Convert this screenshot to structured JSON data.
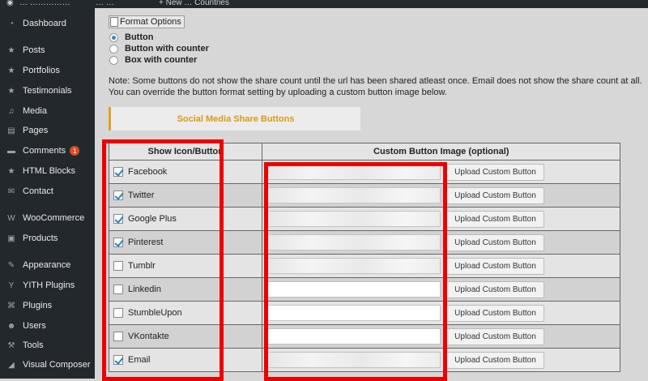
{
  "adminbar": {
    "site_name": "… ……………",
    "counters": "…  …",
    "new_label": "+ New … Countries"
  },
  "sidebar": {
    "items": [
      {
        "label": "Dashboard",
        "icon": "dashboard-icon",
        "glyph": "◔"
      },
      {
        "label": "Posts",
        "icon": "pin-icon",
        "glyph": "★"
      },
      {
        "label": "Portfolios",
        "icon": "pin-icon",
        "glyph": "★"
      },
      {
        "label": "Testimonials",
        "icon": "pin-icon",
        "glyph": "★"
      },
      {
        "label": "Media",
        "icon": "media-icon",
        "glyph": "♫"
      },
      {
        "label": "Pages",
        "icon": "pages-icon",
        "glyph": "▤"
      },
      {
        "label": "Comments",
        "icon": "comment-icon",
        "glyph": "▬",
        "badge": "1"
      },
      {
        "label": "HTML Blocks",
        "icon": "pin-icon",
        "glyph": "★"
      },
      {
        "label": "Contact",
        "icon": "mail-icon",
        "glyph": "✉"
      },
      {
        "label": "WooCommerce",
        "icon": "woocommerce-icon",
        "glyph": "W"
      },
      {
        "label": "Products",
        "icon": "products-icon",
        "glyph": "▣"
      },
      {
        "label": "Appearance",
        "icon": "brush-icon",
        "glyph": "✎"
      },
      {
        "label": "YITH Plugins",
        "icon": "yith-icon",
        "glyph": "Y"
      },
      {
        "label": "Plugins",
        "icon": "plug-icon",
        "glyph": "⌘"
      },
      {
        "label": "Users",
        "icon": "users-icon",
        "glyph": "☻"
      },
      {
        "label": "Tools",
        "icon": "wrench-icon",
        "glyph": "⚒"
      },
      {
        "label": "Visual Composer",
        "icon": "composer-icon",
        "glyph": "◢"
      }
    ]
  },
  "format": {
    "image_alt": "Format Options",
    "options": [
      {
        "label": "Button",
        "checked": true
      },
      {
        "label": "Button with counter",
        "checked": false
      },
      {
        "label": "Box with counter",
        "checked": false
      }
    ]
  },
  "note": "Note: Some buttons do not show the share count until the url has been shared atleast once. Email does not show the share count at all. You can override the button format setting by uploading a custom button image below.",
  "section_title": "Social Media Share Buttons",
  "table": {
    "headers": [
      "Show Icon/Button",
      "Custom Button Image (optional)"
    ],
    "upload_label": "Upload Custom Button",
    "rows": [
      {
        "label": "Facebook",
        "checked": true,
        "url_filled": true
      },
      {
        "label": "Twitter",
        "checked": true,
        "url_filled": true
      },
      {
        "label": "Google Plus",
        "checked": true,
        "url_filled": true
      },
      {
        "label": "Pinterest",
        "checked": true,
        "url_filled": true
      },
      {
        "label": "Tumblr",
        "checked": false,
        "url_filled": true
      },
      {
        "label": "Linkedin",
        "checked": false,
        "url_filled": false
      },
      {
        "label": "StumbleUpon",
        "checked": false,
        "url_filled": false
      },
      {
        "label": "VKontakte",
        "checked": false,
        "url_filled": false
      },
      {
        "label": "Email",
        "checked": true,
        "url_filled": true
      }
    ]
  },
  "colors": {
    "sidebar_bg": "#23282d",
    "accent": "#e0a21e",
    "highlight": "#ee0000",
    "check": "#2c7fc0",
    "badge": "#d54e21"
  }
}
